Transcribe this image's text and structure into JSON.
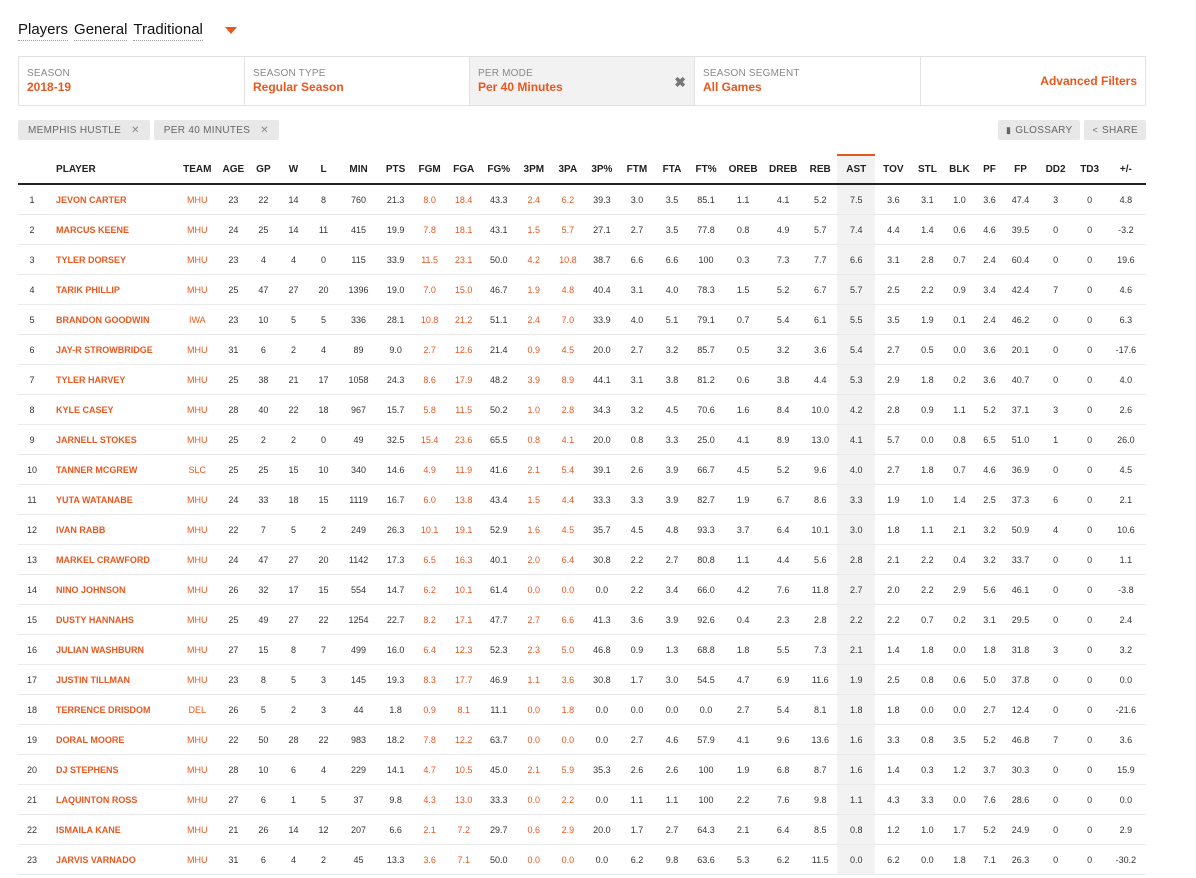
{
  "nav": {
    "words": [
      "Players",
      "General",
      "Traditional"
    ]
  },
  "filters": [
    {
      "label": "SEASON",
      "value": "2018-19"
    },
    {
      "label": "SEASON TYPE",
      "value": "Regular Season"
    },
    {
      "label": "PER MODE",
      "value": "Per 40 Minutes",
      "clear": "✖"
    },
    {
      "label": "SEASON SEGMENT",
      "value": "All Games"
    }
  ],
  "advanced_filters": "Advanced Filters",
  "chips": [
    {
      "label": "MEMPHIS HUSTLE",
      "x": "✕"
    },
    {
      "label": "PER 40 MINUTES",
      "x": "✕"
    }
  ],
  "tools": {
    "glossary": "GLOSSARY",
    "share": "SHARE"
  },
  "columns": [
    "",
    "PLAYER",
    "TEAM",
    "AGE",
    "GP",
    "W",
    "L",
    "MIN",
    "PTS",
    "FGM",
    "FGA",
    "FG%",
    "3PM",
    "3PA",
    "3P%",
    "FTM",
    "FTA",
    "FT%",
    "OREB",
    "DREB",
    "REB",
    "AST",
    "TOV",
    "STL",
    "BLK",
    "PF",
    "FP",
    "DD2",
    "TD3",
    "+/-"
  ],
  "rows": [
    [
      "1",
      "JEVON CARTER",
      "MHU",
      "23",
      "22",
      "14",
      "8",
      "760",
      "21.3",
      "8.0",
      "18.4",
      "43.3",
      "2.4",
      "6.2",
      "39.3",
      "3.0",
      "3.5",
      "85.1",
      "1.1",
      "4.1",
      "5.2",
      "7.5",
      "3.6",
      "3.1",
      "1.0",
      "3.6",
      "47.4",
      "3",
      "0",
      "4.8"
    ],
    [
      "2",
      "MARCUS KEENE",
      "MHU",
      "24",
      "25",
      "14",
      "11",
      "415",
      "19.9",
      "7.8",
      "18.1",
      "43.1",
      "1.5",
      "5.7",
      "27.1",
      "2.7",
      "3.5",
      "77.8",
      "0.8",
      "4.9",
      "5.7",
      "7.4",
      "4.4",
      "1.4",
      "0.6",
      "4.6",
      "39.5",
      "0",
      "0",
      "-3.2"
    ],
    [
      "3",
      "TYLER DORSEY",
      "MHU",
      "23",
      "4",
      "4",
      "0",
      "115",
      "33.9",
      "11.5",
      "23.1",
      "50.0",
      "4.2",
      "10.8",
      "38.7",
      "6.6",
      "6.6",
      "100",
      "0.3",
      "7.3",
      "7.7",
      "6.6",
      "3.1",
      "2.8",
      "0.7",
      "2.4",
      "60.4",
      "0",
      "0",
      "19.6"
    ],
    [
      "4",
      "TARIK PHILLIP",
      "MHU",
      "25",
      "47",
      "27",
      "20",
      "1396",
      "19.0",
      "7.0",
      "15.0",
      "46.7",
      "1.9",
      "4.8",
      "40.4",
      "3.1",
      "4.0",
      "78.3",
      "1.5",
      "5.2",
      "6.7",
      "5.7",
      "2.5",
      "2.2",
      "0.9",
      "3.4",
      "42.4",
      "7",
      "0",
      "4.6"
    ],
    [
      "5",
      "BRANDON GOODWIN",
      "IWA",
      "23",
      "10",
      "5",
      "5",
      "336",
      "28.1",
      "10.8",
      "21.2",
      "51.1",
      "2.4",
      "7.0",
      "33.9",
      "4.0",
      "5.1",
      "79.1",
      "0.7",
      "5.4",
      "6.1",
      "5.5",
      "3.5",
      "1.9",
      "0.1",
      "2.4",
      "46.2",
      "0",
      "0",
      "6.3"
    ],
    [
      "6",
      "JAY-R STROWBRIDGE",
      "MHU",
      "31",
      "6",
      "2",
      "4",
      "89",
      "9.0",
      "2.7",
      "12.6",
      "21.4",
      "0.9",
      "4.5",
      "20.0",
      "2.7",
      "3.2",
      "85.7",
      "0.5",
      "3.2",
      "3.6",
      "5.4",
      "2.7",
      "0.5",
      "0.0",
      "3.6",
      "20.1",
      "0",
      "0",
      "-17.6"
    ],
    [
      "7",
      "TYLER HARVEY",
      "MHU",
      "25",
      "38",
      "21",
      "17",
      "1058",
      "24.3",
      "8.6",
      "17.9",
      "48.2",
      "3.9",
      "8.9",
      "44.1",
      "3.1",
      "3.8",
      "81.2",
      "0.6",
      "3.8",
      "4.4",
      "5.3",
      "2.9",
      "1.8",
      "0.2",
      "3.6",
      "40.7",
      "0",
      "0",
      "4.0"
    ],
    [
      "8",
      "KYLE CASEY",
      "MHU",
      "28",
      "40",
      "22",
      "18",
      "967",
      "15.7",
      "5.8",
      "11.5",
      "50.2",
      "1.0",
      "2.8",
      "34.3",
      "3.2",
      "4.5",
      "70.6",
      "1.6",
      "8.4",
      "10.0",
      "4.2",
      "2.8",
      "0.9",
      "1.1",
      "5.2",
      "37.1",
      "3",
      "0",
      "2.6"
    ],
    [
      "9",
      "JARNELL STOKES",
      "MHU",
      "25",
      "2",
      "2",
      "0",
      "49",
      "32.5",
      "15.4",
      "23.6",
      "65.5",
      "0.8",
      "4.1",
      "20.0",
      "0.8",
      "3.3",
      "25.0",
      "4.1",
      "8.9",
      "13.0",
      "4.1",
      "5.7",
      "0.0",
      "0.8",
      "6.5",
      "51.0",
      "1",
      "0",
      "26.0"
    ],
    [
      "10",
      "TANNER MCGREW",
      "SLC",
      "25",
      "25",
      "15",
      "10",
      "340",
      "14.6",
      "4.9",
      "11.9",
      "41.6",
      "2.1",
      "5.4",
      "39.1",
      "2.6",
      "3.9",
      "66.7",
      "4.5",
      "5.2",
      "9.6",
      "4.0",
      "2.7",
      "1.8",
      "0.7",
      "4.6",
      "36.9",
      "0",
      "0",
      "4.5"
    ],
    [
      "11",
      "YUTA WATANABE",
      "MHU",
      "24",
      "33",
      "18",
      "15",
      "1119",
      "16.7",
      "6.0",
      "13.8",
      "43.4",
      "1.5",
      "4.4",
      "33.3",
      "3.3",
      "3.9",
      "82.7",
      "1.9",
      "6.7",
      "8.6",
      "3.3",
      "1.9",
      "1.0",
      "1.4",
      "2.5",
      "37.3",
      "6",
      "0",
      "2.1"
    ],
    [
      "12",
      "IVAN RABB",
      "MHU",
      "22",
      "7",
      "5",
      "2",
      "249",
      "26.3",
      "10.1",
      "19.1",
      "52.9",
      "1.6",
      "4.5",
      "35.7",
      "4.5",
      "4.8",
      "93.3",
      "3.7",
      "6.4",
      "10.1",
      "3.0",
      "1.8",
      "1.1",
      "2.1",
      "3.2",
      "50.9",
      "4",
      "0",
      "10.6"
    ],
    [
      "13",
      "MARKEL CRAWFORD",
      "MHU",
      "24",
      "47",
      "27",
      "20",
      "1142",
      "17.3",
      "6.5",
      "16.3",
      "40.1",
      "2.0",
      "6.4",
      "30.8",
      "2.2",
      "2.7",
      "80.8",
      "1.1",
      "4.4",
      "5.6",
      "2.8",
      "2.1",
      "2.2",
      "0.4",
      "3.2",
      "33.7",
      "0",
      "0",
      "1.1"
    ],
    [
      "14",
      "NINO JOHNSON",
      "MHU",
      "26",
      "32",
      "17",
      "15",
      "554",
      "14.7",
      "6.2",
      "10.1",
      "61.4",
      "0.0",
      "0.0",
      "0.0",
      "2.2",
      "3.4",
      "66.0",
      "4.2",
      "7.6",
      "11.8",
      "2.7",
      "2.0",
      "2.2",
      "2.9",
      "5.6",
      "46.1",
      "0",
      "0",
      "-3.8"
    ],
    [
      "15",
      "DUSTY HANNAHS",
      "MHU",
      "25",
      "49",
      "27",
      "22",
      "1254",
      "22.7",
      "8.2",
      "17.1",
      "47.7",
      "2.7",
      "6.6",
      "41.3",
      "3.6",
      "3.9",
      "92.6",
      "0.4",
      "2.3",
      "2.8",
      "2.2",
      "2.2",
      "0.7",
      "0.2",
      "3.1",
      "29.5",
      "0",
      "0",
      "2.4"
    ],
    [
      "16",
      "JULIAN WASHBURN",
      "MHU",
      "27",
      "15",
      "8",
      "7",
      "499",
      "16.0",
      "6.4",
      "12.3",
      "52.3",
      "2.3",
      "5.0",
      "46.8",
      "0.9",
      "1.3",
      "68.8",
      "1.8",
      "5.5",
      "7.3",
      "2.1",
      "1.4",
      "1.8",
      "0.0",
      "1.8",
      "31.8",
      "3",
      "0",
      "3.2"
    ],
    [
      "17",
      "JUSTIN TILLMAN",
      "MHU",
      "23",
      "8",
      "5",
      "3",
      "145",
      "19.3",
      "8.3",
      "17.7",
      "46.9",
      "1.1",
      "3.6",
      "30.8",
      "1.7",
      "3.0",
      "54.5",
      "4.7",
      "6.9",
      "11.6",
      "1.9",
      "2.5",
      "0.8",
      "0.6",
      "5.0",
      "37.8",
      "0",
      "0",
      "0.0"
    ],
    [
      "18",
      "TERRENCE DRISDOM",
      "DEL",
      "26",
      "5",
      "2",
      "3",
      "44",
      "1.8",
      "0.9",
      "8.1",
      "11.1",
      "0.0",
      "1.8",
      "0.0",
      "0.0",
      "0.0",
      "0.0",
      "2.7",
      "5.4",
      "8.1",
      "1.8",
      "1.8",
      "0.0",
      "0.0",
      "2.7",
      "12.4",
      "0",
      "0",
      "-21.6"
    ],
    [
      "19",
      "DORAL MOORE",
      "MHU",
      "22",
      "50",
      "28",
      "22",
      "983",
      "18.2",
      "7.8",
      "12.2",
      "63.7",
      "0.0",
      "0.0",
      "0.0",
      "2.7",
      "4.6",
      "57.9",
      "4.1",
      "9.6",
      "13.6",
      "1.6",
      "3.3",
      "0.8",
      "3.5",
      "5.2",
      "46.8",
      "7",
      "0",
      "3.6"
    ],
    [
      "20",
      "DJ STEPHENS",
      "MHU",
      "28",
      "10",
      "6",
      "4",
      "229",
      "14.1",
      "4.7",
      "10.5",
      "45.0",
      "2.1",
      "5.9",
      "35.3",
      "2.6",
      "2.6",
      "100",
      "1.9",
      "6.8",
      "8.7",
      "1.6",
      "1.4",
      "0.3",
      "1.2",
      "3.7",
      "30.3",
      "0",
      "0",
      "15.9"
    ],
    [
      "21",
      "LAQUINTON ROSS",
      "MHU",
      "27",
      "6",
      "1",
      "5",
      "37",
      "9.8",
      "4.3",
      "13.0",
      "33.3",
      "0.0",
      "2.2",
      "0.0",
      "1.1",
      "1.1",
      "100",
      "2.2",
      "7.6",
      "9.8",
      "1.1",
      "4.3",
      "3.3",
      "0.0",
      "7.6",
      "28.6",
      "0",
      "0",
      "0.0"
    ],
    [
      "22",
      "ISMAILA KANE",
      "MHU",
      "21",
      "26",
      "14",
      "12",
      "207",
      "6.6",
      "2.1",
      "7.2",
      "29.7",
      "0.6",
      "2.9",
      "20.0",
      "1.7",
      "2.7",
      "64.3",
      "2.1",
      "6.4",
      "8.5",
      "0.8",
      "1.2",
      "1.0",
      "1.7",
      "5.2",
      "24.9",
      "0",
      "0",
      "2.9"
    ],
    [
      "23",
      "JARVIS VARNADO",
      "MHU",
      "31",
      "6",
      "4",
      "2",
      "45",
      "13.3",
      "3.6",
      "7.1",
      "50.0",
      "0.0",
      "0.0",
      "0.0",
      "6.2",
      "9.8",
      "63.6",
      "5.3",
      "6.2",
      "11.5",
      "0.0",
      "6.2",
      "0.0",
      "1.8",
      "7.1",
      "26.3",
      "0",
      "0",
      "-30.2"
    ]
  ],
  "colors": {
    "accent": "#e8571e",
    "sorted_bg": "#f2f2f2"
  }
}
